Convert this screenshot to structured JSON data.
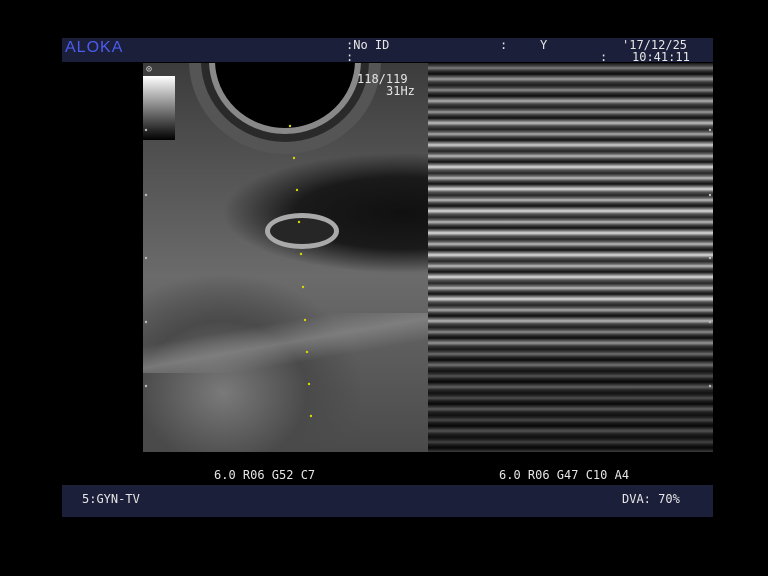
{
  "header": {
    "logo": "ALOKA",
    "patient_id": ":No ID",
    "field_colon": ":",
    "field_y": "Y",
    "second_colon": ":",
    "date": "'17/12/25",
    "time_colon": ":",
    "time": "10:41:11"
  },
  "bmode": {
    "frame": "118/119",
    "frame_rate": "31Hz",
    "params": "6.0 R06 G52 C7"
  },
  "mmode": {
    "params": "6.0 R06 G47 C10 A4"
  },
  "footer": {
    "preset": "5:GYN-TV",
    "dva": "DVA: 70%"
  },
  "colors": {
    "bar_bg": "#1c1f3a",
    "logo": "#4a5cf0",
    "text": "#e6e6e6"
  }
}
